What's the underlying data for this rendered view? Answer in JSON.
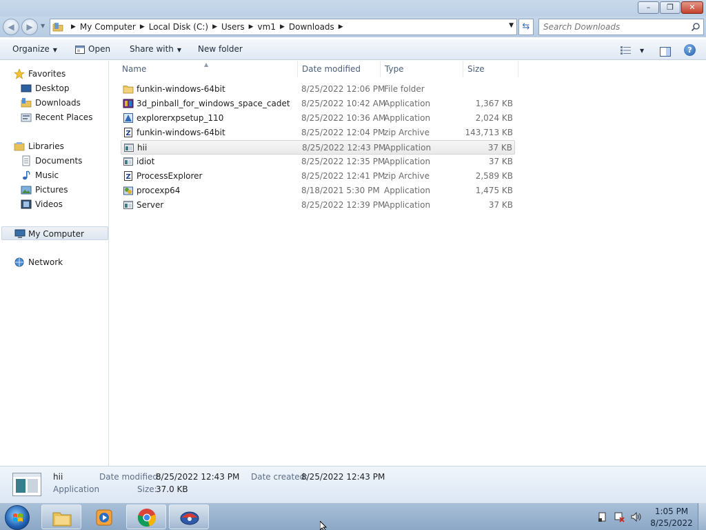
{
  "window": {
    "caption_buttons": {
      "minimize": "–",
      "maximize": "❐",
      "close": "✕"
    }
  },
  "address_bar": {
    "breadcrumbs": [
      "My Computer",
      "Local Disk (C:)",
      "Users",
      "vm1",
      "Downloads"
    ]
  },
  "search": {
    "placeholder": "Search Downloads"
  },
  "toolbar": {
    "organize": "Organize",
    "open": "Open",
    "share_with": "Share with",
    "new_folder": "New folder",
    "help": "?"
  },
  "nav_pane": {
    "favorites": {
      "label": "Favorites",
      "items": [
        "Desktop",
        "Downloads",
        "Recent Places"
      ]
    },
    "libraries": {
      "label": "Libraries",
      "items": [
        "Documents",
        "Music",
        "Pictures",
        "Videos"
      ]
    },
    "computer": "My Computer",
    "network": "Network"
  },
  "columns": {
    "name": "Name",
    "date": "Date modified",
    "type": "Type",
    "size": "Size"
  },
  "files": [
    {
      "name": "funkin-windows-64bit",
      "date": "8/25/2022 12:06 PM",
      "type": "File folder",
      "size": "",
      "icon": "folder-icon"
    },
    {
      "name": "3d_pinball_for_windows_space_cadet",
      "date": "8/25/2022 10:42 AM",
      "type": "Application",
      "size": "1,367 KB",
      "icon": "installer-icon"
    },
    {
      "name": "explorerxpsetup_110",
      "date": "8/25/2022 10:36 AM",
      "type": "Application",
      "size": "2,024 KB",
      "icon": "setup-icon"
    },
    {
      "name": "funkin-windows-64bit",
      "date": "8/25/2022 12:04 PM",
      "type": "zip Archive",
      "size": "143,713 KB",
      "icon": "zip-icon"
    },
    {
      "name": "hii",
      "date": "8/25/2022 12:43 PM",
      "type": "Application",
      "size": "37 KB",
      "icon": "application-icon"
    },
    {
      "name": "idiot",
      "date": "8/25/2022 12:35 PM",
      "type": "Application",
      "size": "37 KB",
      "icon": "application-icon"
    },
    {
      "name": "ProcessExplorer",
      "date": "8/25/2022 12:41 PM",
      "type": "zip Archive",
      "size": "2,589 KB",
      "icon": "zip-icon"
    },
    {
      "name": "procexp64",
      "date": "8/18/2021 5:30 PM",
      "type": "Application",
      "size": "1,475 KB",
      "icon": "procexp-icon"
    },
    {
      "name": "Server",
      "date": "8/25/2022 12:39 PM",
      "type": "Application",
      "size": "37 KB",
      "icon": "application-icon"
    }
  ],
  "selected_index": 4,
  "details": {
    "name": "hii",
    "type": "Application",
    "date_modified_label": "Date modified:",
    "date_modified": "8/25/2022 12:43 PM",
    "date_created_label": "Date created:",
    "date_created": "8/25/2022 12:43 PM",
    "size_label": "Size:",
    "size": "37.0 KB"
  },
  "taskbar": {
    "pinned": [
      "explorer-icon",
      "media-player-icon",
      "chrome-icon",
      "pinball-icon"
    ],
    "clock_time": "1:05 PM",
    "clock_date": "8/25/2022"
  },
  "colors": {
    "accent": "#3b6fb2",
    "selection": "#e9e9e9",
    "taskbar": "#8ba7c6",
    "folder": "#e8c158"
  }
}
